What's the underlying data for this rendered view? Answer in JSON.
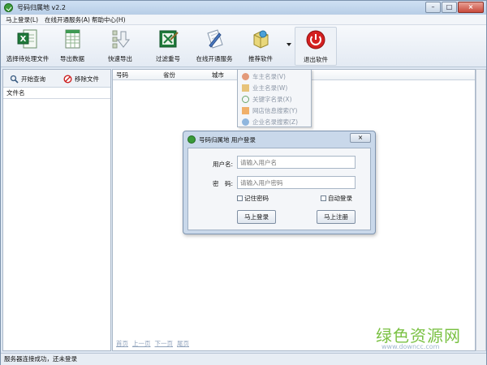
{
  "window": {
    "title": "号码归属地 v2.2"
  },
  "menu": [
    "马上登录(L)",
    "在线开通服务(A)",
    "帮助中心(H)"
  ],
  "toolbar": {
    "items": [
      {
        "label": "选择待处理文件",
        "icon": "excel-file-icon"
      },
      {
        "label": "导出数据",
        "icon": "spreadsheet-icon"
      },
      {
        "label": "快速导出",
        "icon": "download-arrow-icon"
      },
      {
        "label": "过滤重号",
        "icon": "filter-excel-icon"
      },
      {
        "label": "在线开通服务",
        "icon": "document-pen-icon"
      },
      {
        "label": "推荐软件",
        "icon": "software-box-icon"
      },
      {
        "label": "退出软件",
        "icon": "power-icon"
      }
    ]
  },
  "left_panel": {
    "start_query": "开始查询",
    "remove_file": "移除文件",
    "column_header": "文件名"
  },
  "grid": {
    "columns": [
      "号码",
      "省份",
      "城市"
    ],
    "pager": [
      "首页",
      "上一页",
      "下一页",
      "尾页"
    ]
  },
  "dropdown": {
    "items": [
      "车主名录(V)",
      "业主名录(W)",
      "关键字名录(X)",
      "网店信息搜索(Y)",
      "企业名录搜索(Z)"
    ]
  },
  "login_dialog": {
    "title": "号码归属地 用户登录",
    "username_label": "用户名:",
    "username_placeholder": "请输入用户名",
    "password_label": "密　码:",
    "password_placeholder": "请输入用户密码",
    "remember_label": "记住密码",
    "autologin_label": "自动登录",
    "login_button": "马上登录",
    "register_button": "马上注册"
  },
  "status": {
    "text": "服务器连接成功，还未登录"
  },
  "watermark": {
    "name": "绿色资源网",
    "url": "www.downcc.com"
  },
  "colors": {
    "accent_green": "#7ac143",
    "exit_red": "#d42020",
    "window_blue": "#dfe8f3"
  }
}
